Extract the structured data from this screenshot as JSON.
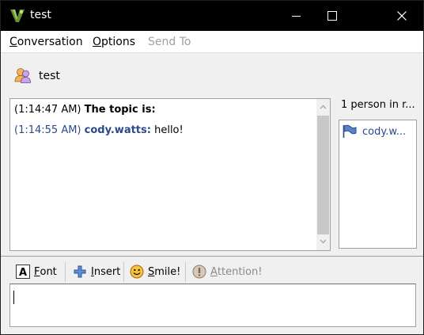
{
  "window": {
    "title": "test"
  },
  "menu": [
    {
      "label": "Conversation",
      "accel": "C",
      "rest": "onversation",
      "enabled": true
    },
    {
      "label": "Options",
      "accel": "O",
      "rest": "ptions",
      "enabled": true
    },
    {
      "label": "Send To",
      "accel": "",
      "rest": "Send To",
      "enabled": false
    }
  ],
  "conversation": {
    "name": "test"
  },
  "messages": [
    {
      "time": "(1:14:47 AM)",
      "text": "The topic is:"
    },
    {
      "time": "(1:14:55 AM)",
      "sender": "cody.watts:",
      "text": "hello!"
    }
  ],
  "users": {
    "count_label": "1 person in r...",
    "list": [
      {
        "name": "cody.w..."
      }
    ]
  },
  "toolbar": {
    "font": {
      "accel": "F",
      "rest": "ont"
    },
    "insert": {
      "accel": "I",
      "rest": "nsert"
    },
    "smile": {
      "accel": "S",
      "rest": "mile!"
    },
    "attention": {
      "accel": "A",
      "rest": "ttention!"
    }
  },
  "colors": {
    "titlebar": "#000000",
    "nick": "#2b4a8a",
    "disabled": "#a0a0a0"
  }
}
